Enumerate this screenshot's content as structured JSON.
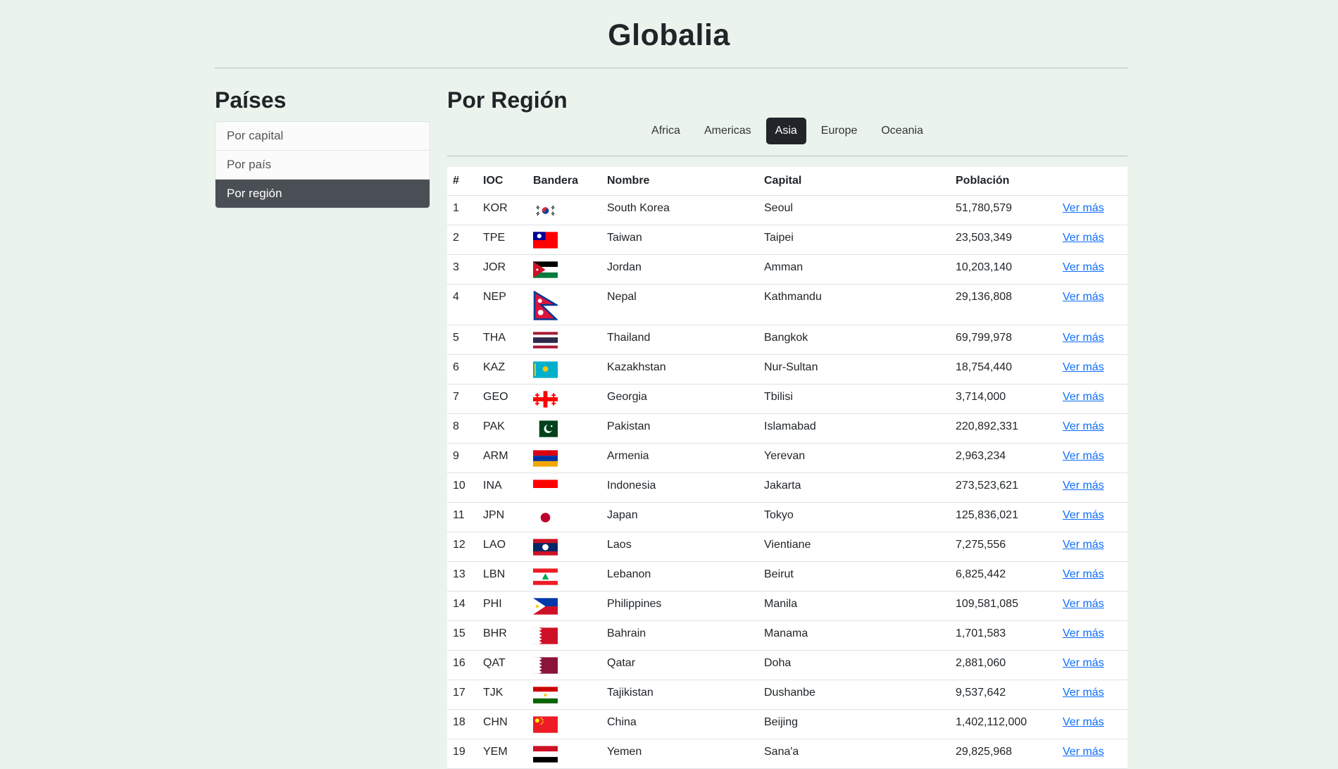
{
  "app": {
    "title": "Globalia"
  },
  "sidebar": {
    "title": "Países",
    "items": [
      {
        "label": "Por capital"
      },
      {
        "label": "Por país"
      },
      {
        "label": "Por región"
      }
    ],
    "active_index": 2
  },
  "main": {
    "title": "Por Región",
    "tabs": [
      {
        "label": "Africa"
      },
      {
        "label": "Americas"
      },
      {
        "label": "Asia"
      },
      {
        "label": "Europe"
      },
      {
        "label": "Oceania"
      }
    ],
    "active_tab": 2
  },
  "table": {
    "headers": {
      "num": "#",
      "ioc": "IOC",
      "flag": "Bandera",
      "name": "Nombre",
      "capital": "Capital",
      "population": "Población"
    },
    "link_label": "Ver más",
    "rows": [
      {
        "num": "1",
        "ioc": "KOR",
        "flag": "south-korea-flag",
        "name": "South Korea",
        "capital": "Seoul",
        "population": "51,780,579"
      },
      {
        "num": "2",
        "ioc": "TPE",
        "flag": "taiwan-flag",
        "name": "Taiwan",
        "capital": "Taipei",
        "population": "23,503,349"
      },
      {
        "num": "3",
        "ioc": "JOR",
        "flag": "jordan-flag",
        "name": "Jordan",
        "capital": "Amman",
        "population": "10,203,140"
      },
      {
        "num": "4",
        "ioc": "NEP",
        "flag": "nepal-flag",
        "name": "Nepal",
        "capital": "Kathmandu",
        "population": "29,136,808"
      },
      {
        "num": "5",
        "ioc": "THA",
        "flag": "thailand-flag",
        "name": "Thailand",
        "capital": "Bangkok",
        "population": "69,799,978"
      },
      {
        "num": "6",
        "ioc": "KAZ",
        "flag": "kazakhstan-flag",
        "name": "Kazakhstan",
        "capital": "Nur-Sultan",
        "population": "18,754,440"
      },
      {
        "num": "7",
        "ioc": "GEO",
        "flag": "georgia-flag",
        "name": "Georgia",
        "capital": "Tbilisi",
        "population": "3,714,000"
      },
      {
        "num": "8",
        "ioc": "PAK",
        "flag": "pakistan-flag",
        "name": "Pakistan",
        "capital": "Islamabad",
        "population": "220,892,331"
      },
      {
        "num": "9",
        "ioc": "ARM",
        "flag": "armenia-flag",
        "name": "Armenia",
        "capital": "Yerevan",
        "population": "2,963,234"
      },
      {
        "num": "10",
        "ioc": "INA",
        "flag": "indonesia-flag",
        "name": "Indonesia",
        "capital": "Jakarta",
        "population": "273,523,621"
      },
      {
        "num": "11",
        "ioc": "JPN",
        "flag": "japan-flag",
        "name": "Japan",
        "capital": "Tokyo",
        "population": "125,836,021"
      },
      {
        "num": "12",
        "ioc": "LAO",
        "flag": "laos-flag",
        "name": "Laos",
        "capital": "Vientiane",
        "population": "7,275,556"
      },
      {
        "num": "13",
        "ioc": "LBN",
        "flag": "lebanon-flag",
        "name": "Lebanon",
        "capital": "Beirut",
        "population": "6,825,442"
      },
      {
        "num": "14",
        "ioc": "PHI",
        "flag": "philippines-flag",
        "name": "Philippines",
        "capital": "Manila",
        "population": "109,581,085"
      },
      {
        "num": "15",
        "ioc": "BHR",
        "flag": "bahrain-flag",
        "name": "Bahrain",
        "capital": "Manama",
        "population": "1,701,583"
      },
      {
        "num": "16",
        "ioc": "QAT",
        "flag": "qatar-flag",
        "name": "Qatar",
        "capital": "Doha",
        "population": "2,881,060"
      },
      {
        "num": "17",
        "ioc": "TJK",
        "flag": "tajikistan-flag",
        "name": "Tajikistan",
        "capital": "Dushanbe",
        "population": "9,537,642"
      },
      {
        "num": "18",
        "ioc": "CHN",
        "flag": "china-flag",
        "name": "China",
        "capital": "Beijing",
        "population": "1,402,112,000"
      },
      {
        "num": "19",
        "ioc": "YEM",
        "flag": "yemen-flag",
        "name": "Yemen",
        "capital": "Sana'a",
        "population": "29,825,968"
      }
    ]
  }
}
